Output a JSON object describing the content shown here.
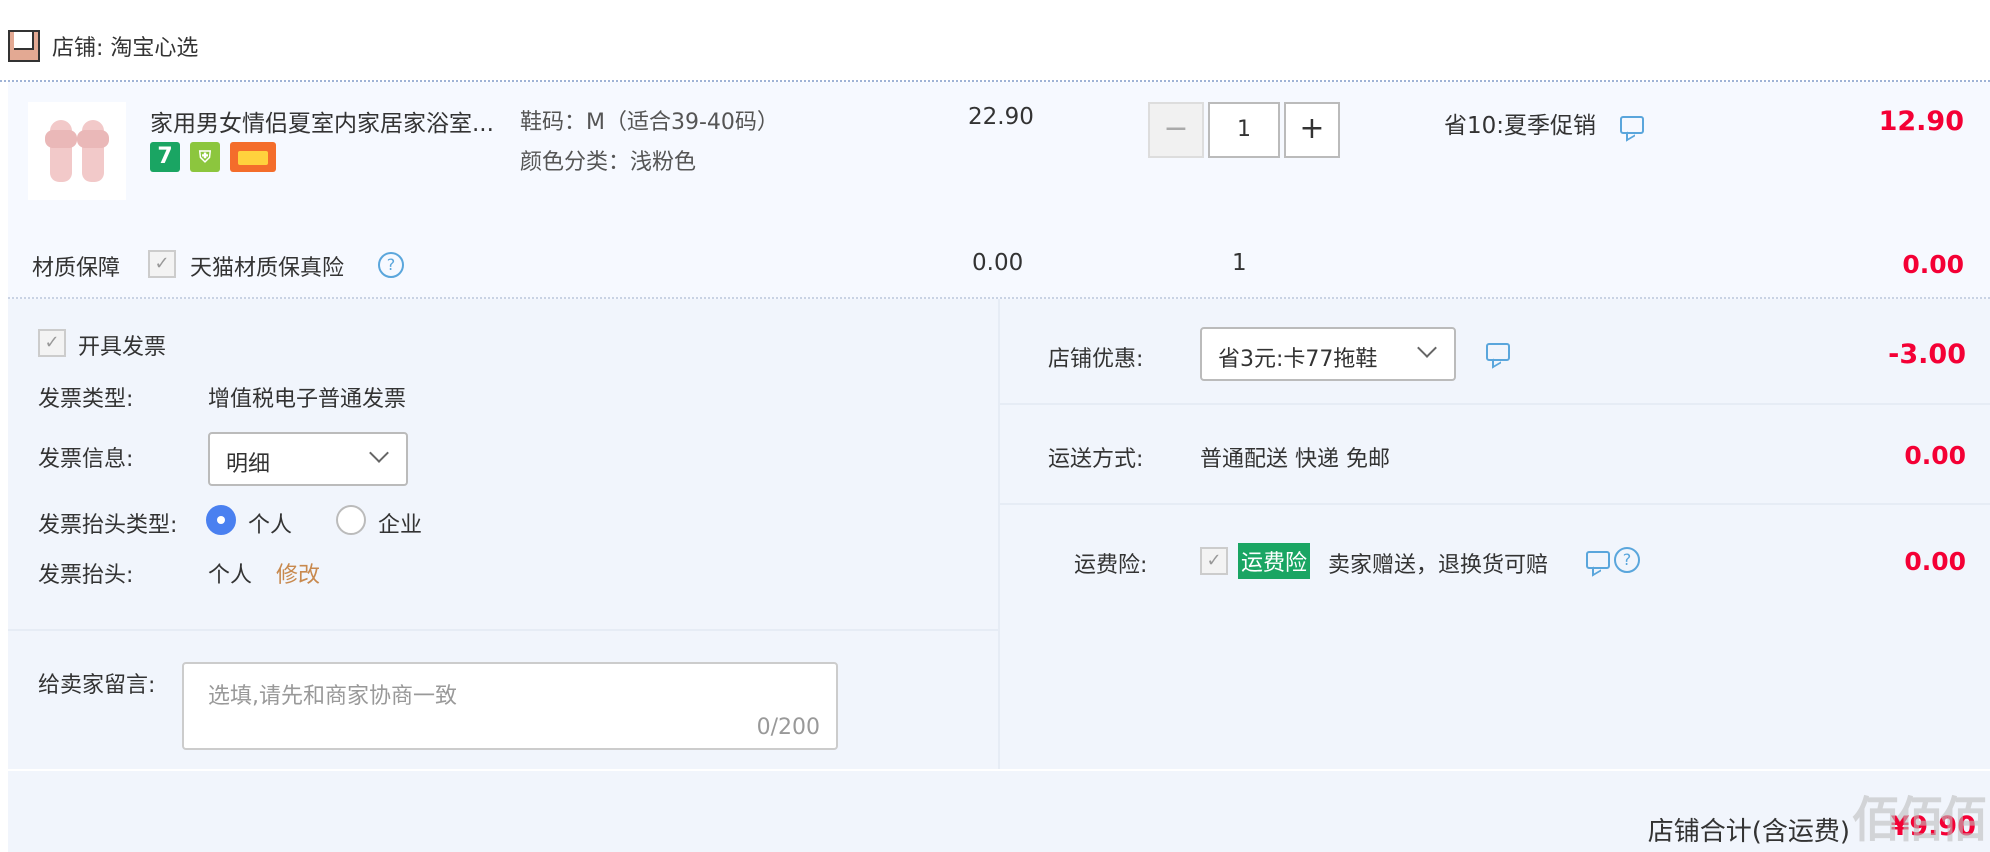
{
  "shop": {
    "label": "店铺: 淘宝心选"
  },
  "item": {
    "title": "家用男女情侣夏室内家居家浴室...",
    "sku_size": "鞋码：M（适合39-40码）",
    "sku_color": "颜色分类：浅粉色",
    "unit_price": "22.90",
    "quantity": "1",
    "minus": "−",
    "plus": "+",
    "promo": "省10:夏季促销",
    "subtotal": "12.90",
    "tags": {
      "seven_day": "7"
    }
  },
  "material_guarantee": {
    "label": "材质保障",
    "name": "天猫材质保真险",
    "price": "0.00",
    "quantity": "1",
    "subtotal": "0.00"
  },
  "invoice": {
    "toggle_label": "开具发票",
    "type_label": "发票类型:",
    "type_value": "增值税电子普通发票",
    "info_label": "发票信息:",
    "info_selected": "明细",
    "head_type_label": "发票抬头类型:",
    "head_type_options": [
      "个人",
      "企业"
    ],
    "head_label": "发票抬头:",
    "head_value": "个人",
    "edit_link": "修改"
  },
  "message": {
    "label": "给卖家留言:",
    "placeholder": "选填,请先和商家协商一致",
    "counter": "0/200"
  },
  "coupon": {
    "label": "店铺优惠:",
    "selected": "省3元:卡77拖鞋",
    "amount": "-3.00"
  },
  "shipping": {
    "label": "运送方式:",
    "value": "普通配送 快递 免邮",
    "amount": "0.00"
  },
  "insurance": {
    "label": "运费险:",
    "badge": "运费险",
    "text": "卖家赠送，退换货可赔",
    "amount": "0.00"
  },
  "footer": {
    "label": "店铺合计(含运费)",
    "total": "¥9.90"
  },
  "watermark": "佰佰佰",
  "colors": {
    "price_red": "#f40035",
    "link_orange": "#c8894e",
    "badge_green": "#1aa563",
    "radio_blue": "#4a80f0",
    "panel_bg": "#f1f5fc"
  }
}
